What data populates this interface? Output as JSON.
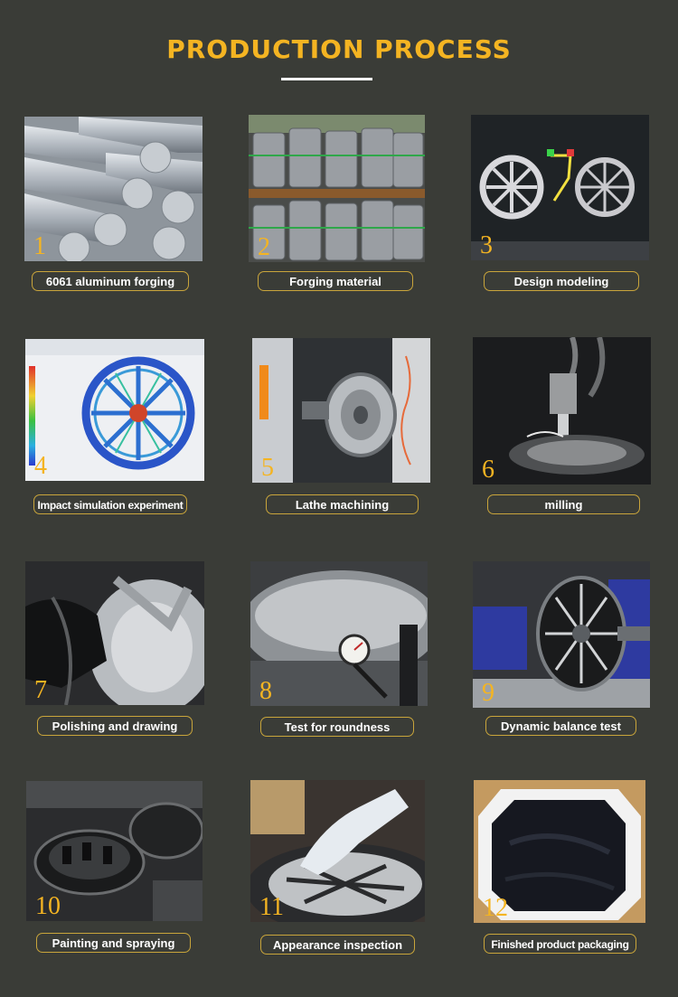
{
  "header": {
    "title": "PRODUCTION PROCESS"
  },
  "colors": {
    "background": "#3a3c37",
    "accent": "#f4b422",
    "pill_border": "#c9a53b"
  },
  "steps": [
    {
      "number": "1",
      "label": "6061 aluminum forging"
    },
    {
      "number": "2",
      "label": "Forging material"
    },
    {
      "number": "3",
      "label": "Design modeling"
    },
    {
      "number": "4",
      "label": "Impact simulation experiment"
    },
    {
      "number": "5",
      "label": "Lathe machining"
    },
    {
      "number": "6",
      "label": "milling"
    },
    {
      "number": "7",
      "label": "Polishing and drawing"
    },
    {
      "number": "8",
      "label": "Test for roundness"
    },
    {
      "number": "9",
      "label": "Dynamic balance test"
    },
    {
      "number": "10",
      "label": "Painting and spraying"
    },
    {
      "number": "11",
      "label": "Appearance inspection"
    },
    {
      "number": "12",
      "label": "Finished product packaging"
    }
  ]
}
